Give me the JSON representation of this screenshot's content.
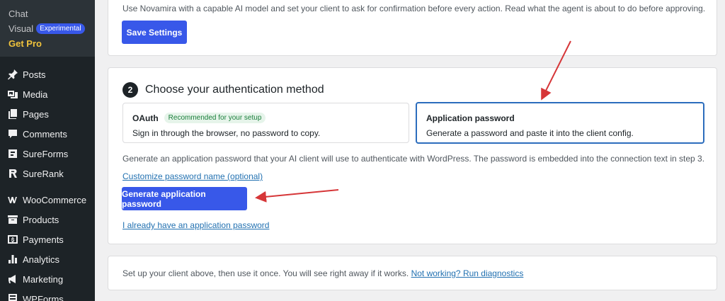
{
  "sidebar": {
    "sub_items": [
      {
        "label": "Chat"
      },
      {
        "label": "Visual",
        "badge": "Experimental"
      },
      {
        "label": "Get Pro"
      }
    ],
    "items": [
      {
        "label": "Posts",
        "icon": "pin-icon"
      },
      {
        "label": "Media",
        "icon": "media-icon"
      },
      {
        "label": "Pages",
        "icon": "pages-icon"
      },
      {
        "label": "Comments",
        "icon": "comment-icon"
      },
      {
        "label": "SureForms",
        "icon": "sureforms-icon"
      },
      {
        "label": "SureRank",
        "icon": "surerank-icon"
      },
      {
        "label": "WooCommerce",
        "icon": "woocommerce-icon"
      },
      {
        "label": "Products",
        "icon": "archive-icon"
      },
      {
        "label": "Payments",
        "icon": "dollar-icon"
      },
      {
        "label": "Analytics",
        "icon": "bar-chart-icon"
      },
      {
        "label": "Marketing",
        "icon": "megaphone-icon"
      },
      {
        "label": "WPForms",
        "icon": "forms-icon"
      }
    ]
  },
  "top_card": {
    "text": "Use Novamira with a capable AI model and set your client to ask for confirmation before every action. Read what the agent is about to do before approving.",
    "save_label": "Save Settings"
  },
  "auth": {
    "step": "2",
    "title": "Choose your authentication method",
    "options": [
      {
        "title": "OAuth",
        "badge": "Recommended for your setup",
        "desc": "Sign in through the browser, no password to copy."
      },
      {
        "title": "Application password",
        "desc": "Generate a password and paste it into the client config."
      }
    ],
    "selected": "Application password",
    "help": "Generate an application password that your AI client will use to authenticate with WordPress. The password is embedded into the connection text in step 3.",
    "customize_link": "Customize password name (optional)",
    "generate_label": "Generate application password",
    "have_link": "I already have an application password"
  },
  "bottom_card": {
    "text": "Set up your client above, then use it once. You will see right away if it works.",
    "link": "Not working? Run diagnostics"
  },
  "colors": {
    "accent": "#3858e9",
    "selected_border": "#2c6dbd",
    "annotation_arrow": "#d63638",
    "sidebar_bg": "#1d2327"
  }
}
